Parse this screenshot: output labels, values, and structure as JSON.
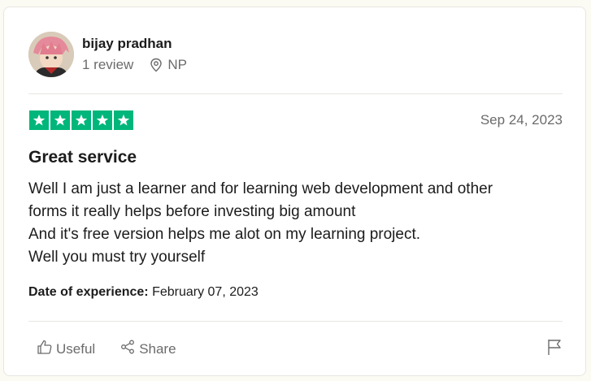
{
  "reviewer": {
    "name": "bijay pradhan",
    "review_count": "1 review",
    "country": "NP"
  },
  "review": {
    "rating": 5,
    "rating_max": 5,
    "date": "Sep 24, 2023",
    "title": "Great service",
    "body_lines": [
      "Well I am just a learner and for learning web development and other",
      "forms it really helps before investing big amount",
      "And it's free version helps me alot on my learning project.",
      "Well you must try yourself"
    ],
    "experience_label": "Date of experience:",
    "experience_date": "February 07, 2023"
  },
  "actions": {
    "useful_label": "Useful",
    "share_label": "Share"
  },
  "icons": {
    "location": "location-pin-icon",
    "useful": "thumbs-up-icon",
    "share": "share-icon",
    "report": "flag-icon"
  },
  "colors": {
    "star_green": "#00b67a",
    "background": "#fcfbf3",
    "muted_text": "#6b6b6b"
  }
}
